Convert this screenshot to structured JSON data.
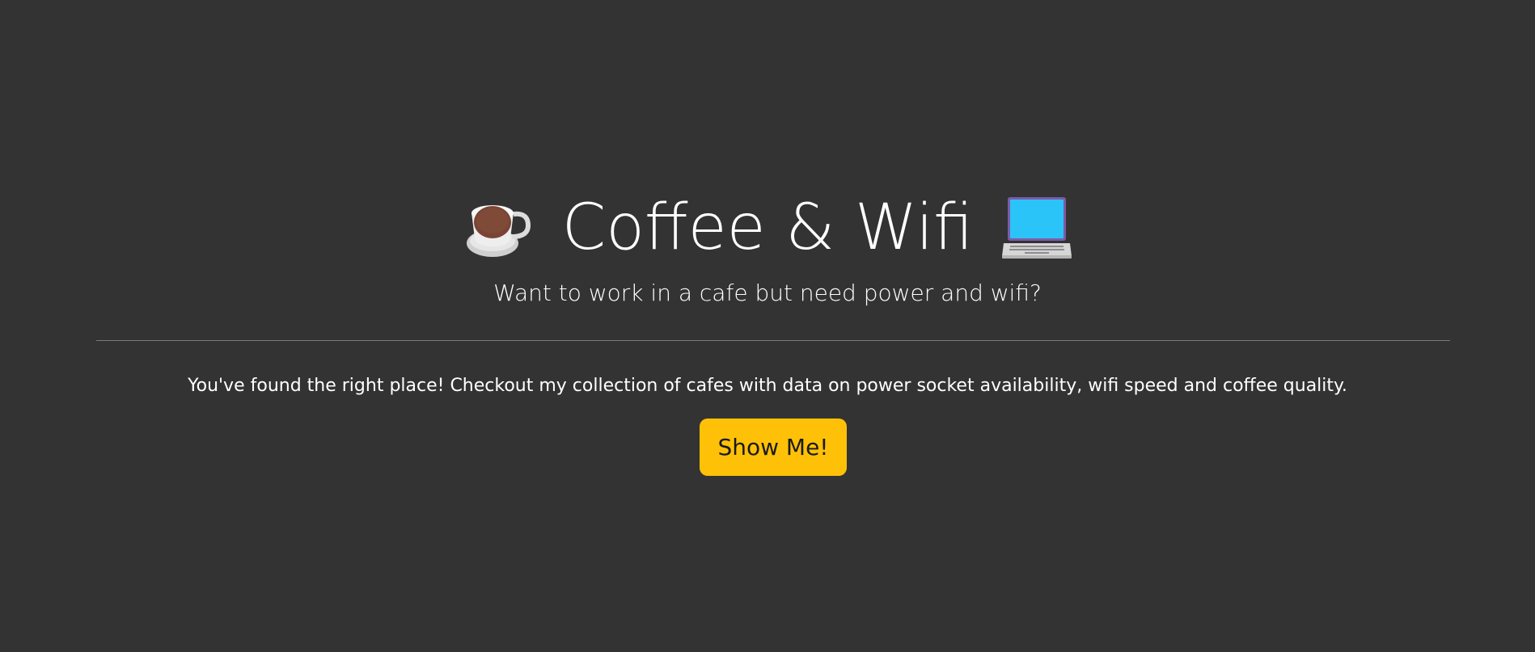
{
  "hero": {
    "title": "Coffee & Wifi",
    "left_icon": "hot-beverage-icon",
    "right_icon": "laptop-icon",
    "subtitle": "Want to work in a cafe but need power and wifi?"
  },
  "intro": {
    "text": "You've found the right place! Checkout my collection of cafes with data on power socket availability, wifi speed and coffee quality."
  },
  "cta": {
    "label": "Show Me!"
  },
  "colors": {
    "background": "#333333",
    "accent": "#ffc107",
    "text": "#ffffff",
    "divider": "#7a7a7a"
  }
}
